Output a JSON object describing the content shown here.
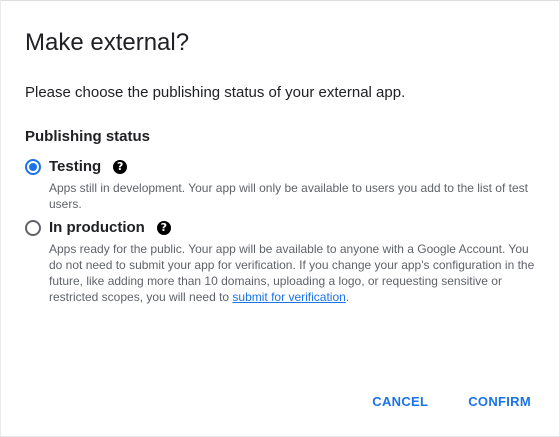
{
  "dialog": {
    "title": "Make external?",
    "lead": "Please choose the publishing status of your external app.",
    "section_label": "Publishing status",
    "options": [
      {
        "label": "Testing",
        "checked": true,
        "help_icon": "help-circle-icon",
        "description": "Apps still in development. Your app will only be available to users you add to the list of test users."
      },
      {
        "label": "In production",
        "checked": false,
        "help_icon": "help-circle-icon",
        "description_before_link": "Apps ready for the public. Your app will be available to anyone with a Google Account. You do not need to submit your app for verification. If you change your app's configuration in the future, like adding more than 10 domains, uploading a logo, or requesting sensitive or restricted scopes, you will need to ",
        "link_text": "submit for verification",
        "description_after_link": "."
      }
    ],
    "buttons": {
      "cancel": "CANCEL",
      "confirm": "CONFIRM"
    },
    "colors": {
      "accent": "#1a73e8",
      "text": "#202124",
      "secondary_text": "#5f6368"
    }
  }
}
